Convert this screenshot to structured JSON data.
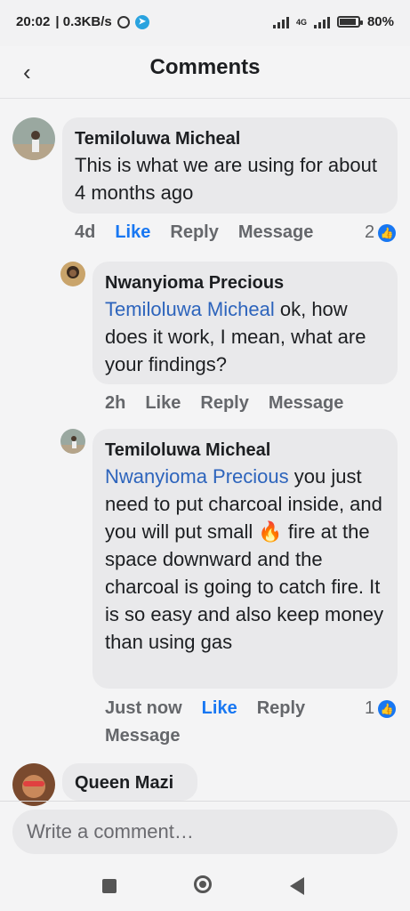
{
  "status_bar": {
    "time": "20:02",
    "speed": "| 0.3KB/s",
    "network": "4G",
    "battery": "80%",
    "battery_level": 0.8
  },
  "header": {
    "back_icon": "chevron-left-icon",
    "title": "Comments"
  },
  "comments": [
    {
      "author": "Temiloluwa Micheal",
      "text": "This is what we are using for about 4 months ago",
      "mention": "",
      "time": "4d",
      "like": "Like",
      "reply": "Reply",
      "message": "Message",
      "reaction_count": "2"
    },
    {
      "author": "Nwanyioma Precious",
      "mention": "Temiloluwa Micheal",
      "text": " ok, how does it work, I mean, what are your findings?",
      "time": "2h",
      "like": "Like",
      "reply": "Reply",
      "message": "Message"
    },
    {
      "author": "Temiloluwa Micheal",
      "mention": "Nwanyioma Precious",
      "text_before_emoji": " you just need to put charcoal inside, and you will put small ",
      "emoji": "🔥",
      "text_after_emoji": " fire at the space downward and the charcoal is going to catch fire. It is so easy and also keep money than using gas",
      "time": "Just now",
      "like": "Like",
      "reply": "Reply",
      "message": "Message",
      "reaction_count": "1"
    },
    {
      "author": "Queen Mazi"
    }
  ],
  "composer": {
    "placeholder": "Write a comment…"
  },
  "colors": {
    "accent": "#1877f2",
    "mention": "#2d64bc",
    "bubble": "#e9e9eb"
  }
}
